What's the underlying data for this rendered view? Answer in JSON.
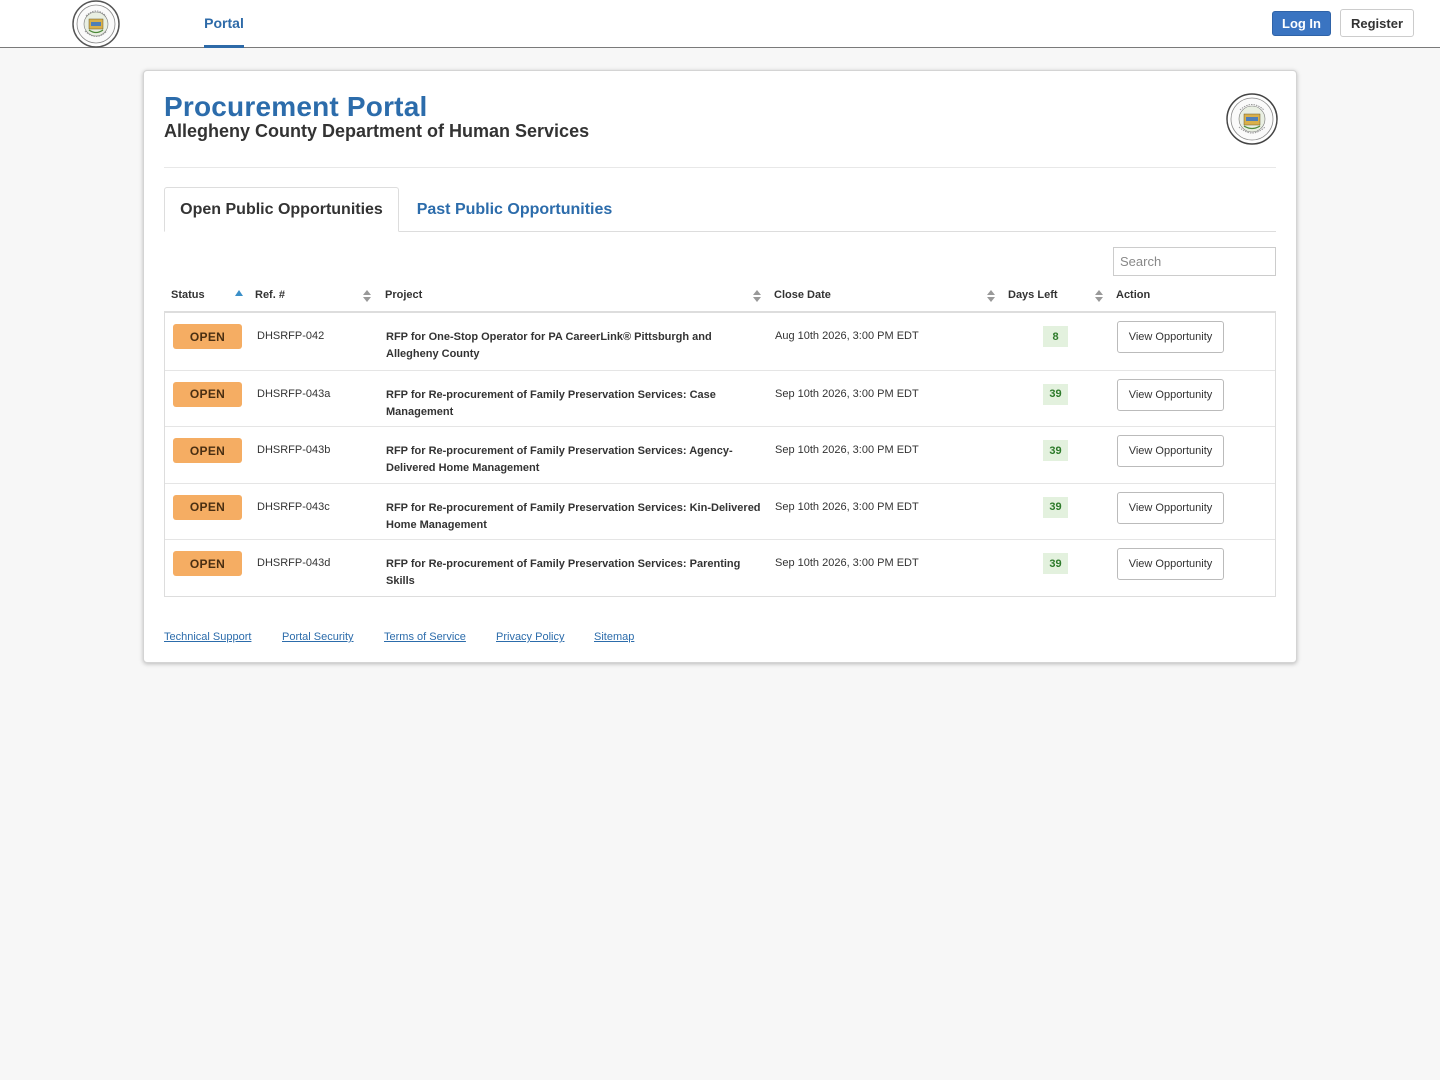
{
  "nav": {
    "portal_label": "Portal",
    "login_label": "Log In",
    "register_label": "Register"
  },
  "header": {
    "title": "Procurement Portal",
    "subtitle": "Allegheny County Department of Human Services"
  },
  "tabs": [
    {
      "label": "Open Public Opportunities",
      "active": true
    },
    {
      "label": "Past Public Opportunities",
      "active": false
    }
  ],
  "search": {
    "placeholder": "Search",
    "value": ""
  },
  "table": {
    "columns": [
      "Status",
      "Ref. #",
      "Project",
      "Close Date",
      "Days Left",
      "Action"
    ],
    "rows": [
      {
        "status": "OPEN",
        "ref": "DHSRFP-042",
        "project": "RFP for One-Stop Operator for PA CareerLink® Pittsburgh and Allegheny County",
        "close_date": "Aug 10th 2026, 3:00 PM EDT",
        "days_left": "8",
        "action": "View Opportunity"
      },
      {
        "status": "OPEN",
        "ref": "DHSRFP-043a",
        "project": "RFP for Re-procurement of Family Preservation Services: Case Management",
        "close_date": "Sep 10th 2026, 3:00 PM EDT",
        "days_left": "39",
        "action": "View Opportunity"
      },
      {
        "status": "OPEN",
        "ref": "DHSRFP-043b",
        "project": "RFP for Re-procurement of Family Preservation Services: Agency-Delivered Home Management",
        "close_date": "Sep 10th 2026, 3:00 PM EDT",
        "days_left": "39",
        "action": "View Opportunity"
      },
      {
        "status": "OPEN",
        "ref": "DHSRFP-043c",
        "project": "RFP for Re-procurement of Family Preservation Services: Kin-Delivered Home Management",
        "close_date": "Sep 10th 2026, 3:00 PM EDT",
        "days_left": "39",
        "action": "View Opportunity"
      },
      {
        "status": "OPEN",
        "ref": "DHSRFP-043d",
        "project": "RFP for Re-procurement of Family Preservation Services: Parenting Skills",
        "close_date": "Sep 10th 2026, 3:00 PM EDT",
        "days_left": "39",
        "action": "View Opportunity"
      }
    ]
  },
  "footer": {
    "links": [
      "Technical Support",
      "Portal Security",
      "Terms of Service",
      "Privacy Policy",
      "Sitemap"
    ]
  },
  "colors": {
    "brand_blue": "#2c6cab",
    "login_blue": "#3a74c1",
    "open_badge": "#f5ad63",
    "days_badge_bg": "#e3f1de",
    "days_badge_text": "#2d7a2a"
  },
  "icons": {
    "nav_logo": "county-seal-icon",
    "card_logo": "county-seal-icon",
    "sort_asc": "sort-asc-icon",
    "sort_both": "sort-both-icon"
  }
}
